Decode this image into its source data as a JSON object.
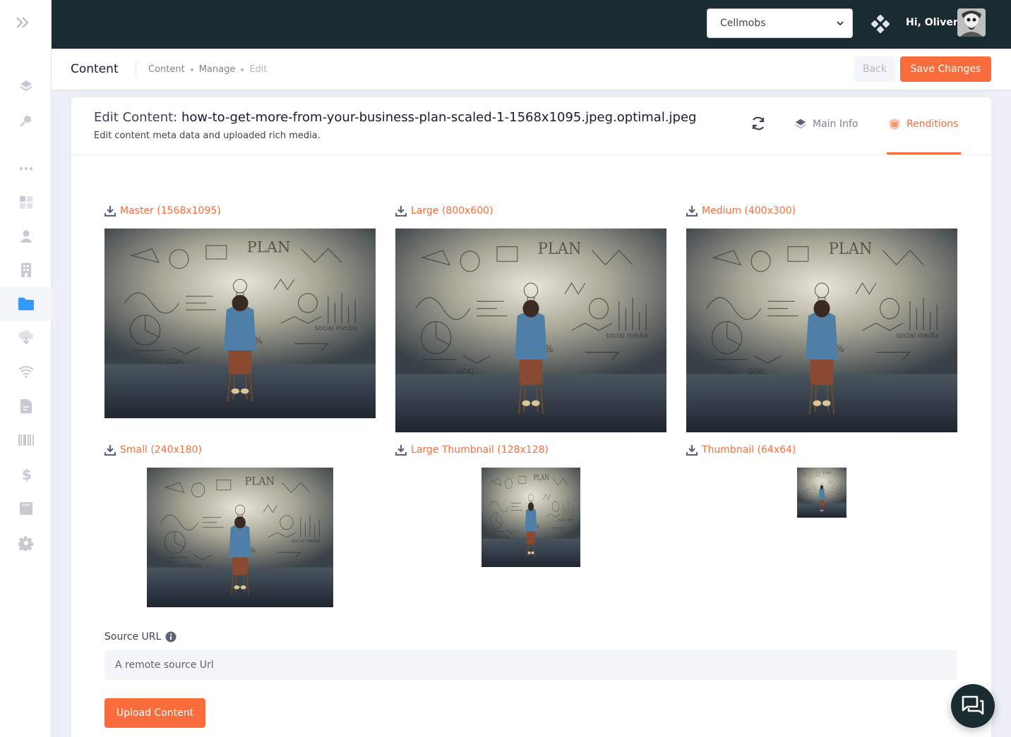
{
  "header": {
    "tenant_selected": "Cellmobs",
    "greeting": "Hi, Oliver",
    "avatar_icon": "user-avatar"
  },
  "sidebar": {
    "items": [
      {
        "icon": "layers-icon"
      },
      {
        "icon": "key-icon"
      },
      {
        "icon": "more-dots-icon"
      },
      {
        "icon": "dashboard-icon"
      },
      {
        "icon": "user-icon"
      },
      {
        "icon": "building-icon"
      },
      {
        "icon": "folder-icon",
        "active": true
      },
      {
        "icon": "cloud-download-icon"
      },
      {
        "icon": "wifi-icon"
      },
      {
        "icon": "document-icon"
      },
      {
        "icon": "barcode-icon"
      },
      {
        "icon": "dollar-icon"
      },
      {
        "icon": "book-icon"
      },
      {
        "icon": "gear-icon"
      }
    ]
  },
  "subheader": {
    "title": "Content",
    "breadcrumb": [
      "Content",
      "Manage",
      "Edit"
    ],
    "back_label": "Back",
    "save_label": "Save Changes"
  },
  "card": {
    "title_prefix": "Edit Content:",
    "filename": "how-to-get-more-from-your-business-plan-scaled-1-1568x1095.jpeg.optimal.jpeg",
    "subtitle": "Edit content meta data and uploaded rich media.",
    "tabs": [
      {
        "label": "Main Info",
        "icon": "layers-icon",
        "active": false
      },
      {
        "label": "Renditions",
        "icon": "shield-icon",
        "active": true
      }
    ]
  },
  "renditions": [
    {
      "label": "Master (1568x1095)"
    },
    {
      "label": "Large (800x600)"
    },
    {
      "label": "Medium (400x300)"
    },
    {
      "label": "Small (240x180)"
    },
    {
      "label": "Large Thumbnail (128x128)"
    },
    {
      "label": "Thumbnail (64x64)"
    }
  ],
  "source": {
    "label": "Source URL",
    "placeholder": "A remote source Url",
    "upload_label": "Upload Content"
  },
  "colors": {
    "accent": "#f96c3c",
    "topbar": "#1a2b32",
    "sidebar_active_icon": "#3699ff"
  }
}
